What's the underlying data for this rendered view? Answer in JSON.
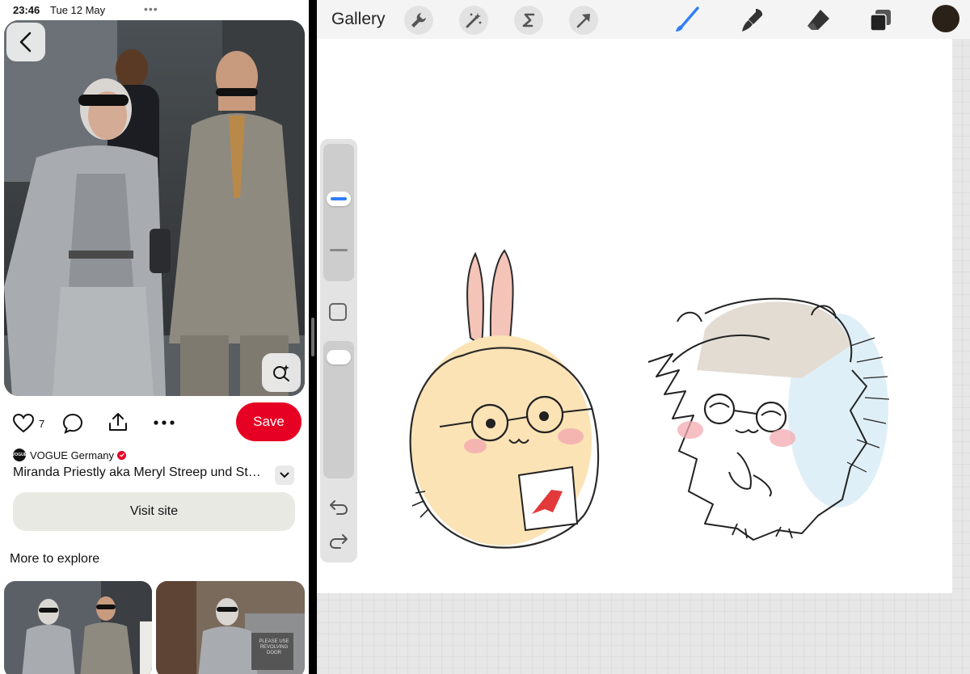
{
  "status_bar": {
    "time": "23:46",
    "date": "Tue 12 May",
    "more": "•••"
  },
  "pin": {
    "like_count": "7",
    "save_label": "Save",
    "source_name": "VOGUE Germany",
    "source_logo": "VOGUE",
    "title": "Miranda Priestly aka Meryl Streep und Stanley Tucci",
    "visit_label": "Visit site",
    "more_label": "More to explore",
    "thumb_sign": "PLEASE USE REVOLVING DOOR"
  },
  "procreate": {
    "gallery_label": "Gallery",
    "tools_left": [
      "wrench-icon",
      "magic-wand-icon",
      "selection-icon",
      "transform-icon"
    ],
    "tools_right": [
      "brush-icon",
      "smudge-icon",
      "eraser-icon",
      "layers-icon"
    ],
    "active_tool": "brush-icon",
    "current_color": "#2a2218",
    "accent_color": "#2f7ef5",
    "brush_size": 0.62,
    "brush_opacity": 0.95
  },
  "colors": {
    "save": "#e60023",
    "visit": "#e9e9e4"
  }
}
